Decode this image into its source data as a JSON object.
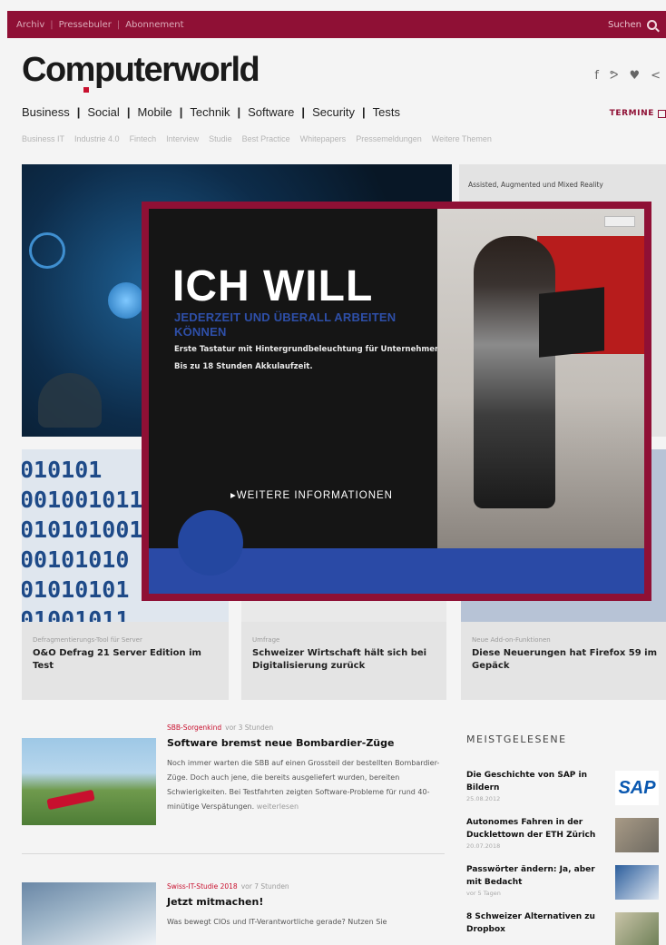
{
  "topbar": {
    "links": [
      "Archiv",
      "Pressebuler",
      "Abonnement"
    ],
    "search_label": "Suchen"
  },
  "brand": {
    "logo": "Computerworld",
    "accent_color": "#8f1035"
  },
  "social_icons": [
    "facebook-icon",
    "rss-icon",
    "twitter-icon",
    "share-icon"
  ],
  "main_nav": [
    "Business",
    "Social",
    "Mobile",
    "Technik",
    "Software",
    "Security",
    "Tests"
  ],
  "termine": "TERMINE",
  "sub_nav": [
    "Business IT",
    "Industrie 4.0",
    "Fintech",
    "Interview",
    "Studie",
    "Best Practice",
    "Whitepapers",
    "Pressemeldungen",
    "Weitere Themen"
  ],
  "side_top": {
    "kicker": "Assisted, Augmented und Mixed Reality"
  },
  "teasers": [
    {
      "kicker": "Defragmentierungs-Tool für Server",
      "title": "O&O Defrag 21 Server Edition im Test"
    },
    {
      "kicker": "Umfrage",
      "title": "Schweizer Wirtschaft hält sich bei Digitalisierung zurück"
    },
    {
      "kicker": "Neue Add-on-Funktionen",
      "title": "Diese Neuerungen hat Firefox 59 im Gepäck"
    }
  ],
  "ad": {
    "headline": "ICH WILL",
    "subline": "JEDERZEIT UND ÜBERALL ARBEITEN KÖNNEN",
    "copy": "Erste Tastatur mit Hintergrundbeleuchtung für Unternehmen. Bis zu 18 Stunden Akkulaufzeit.",
    "cta": "WEITERE INFORMATIONEN"
  },
  "articles": [
    {
      "kicker": "SBB-Sorgenkind",
      "time": "vor 3 Stunden",
      "title": "Software bremst neue Bombardier-Züge",
      "body": "Noch immer warten die SBB auf einen Grossteil der bestellten Bombardier-Züge. Doch auch jene, die bereits ausgeliefert wurden, bereiten Schwierigkeiten. Bei Testfahrten zeigten Software-Probleme für rund 40-minütige Verspätungen.",
      "more": "weiterlesen"
    },
    {
      "kicker": "Swiss-IT-Studie 2018",
      "time": "vor 7 Stunden",
      "title": "Jetzt mitmachen!",
      "body": "Was bewegt CIOs und IT-Verantwortliche gerade? Nutzen Sie",
      "more": ""
    }
  ],
  "popular": {
    "heading": "MEISTGELESENE",
    "items": [
      {
        "title": "Die Geschichte von SAP in Bildern",
        "date": "25.08.2012",
        "thumb": "SAP"
      },
      {
        "title": "Autonomes Fahren in der Ducklettown der ETH Zürich",
        "date": "20.07.2018",
        "thumb": ""
      },
      {
        "title": "Passwörter ändern: Ja, aber mit Bedacht",
        "date": "vor 5 Tagen",
        "thumb": ""
      },
      {
        "title": "8 Schweizer Alternativen zu Dropbox",
        "date": "",
        "thumb": ""
      }
    ]
  }
}
